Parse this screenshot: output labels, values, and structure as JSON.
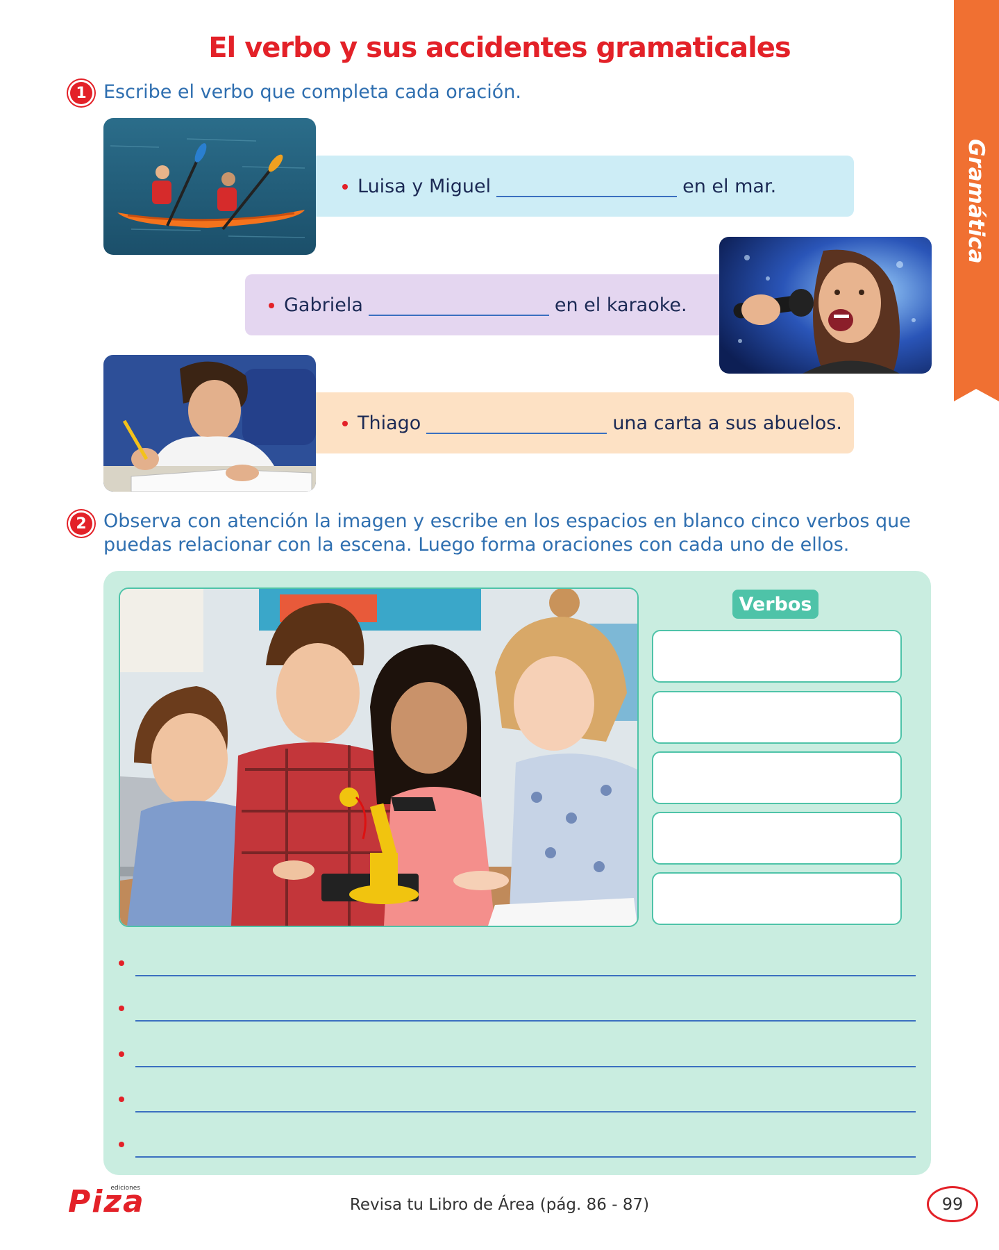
{
  "side_tab": {
    "label": "Gramática",
    "color": "#f07032"
  },
  "title": "El verbo y sus accidentes gramaticales",
  "activity1": {
    "number": "1",
    "instruction": "Escribe el verbo que completa cada oración.",
    "sentences": [
      {
        "before": "Luisa y Miguel",
        "after": "en el mar.",
        "bg": "#cdedf6"
      },
      {
        "before": "Gabriela",
        "after": "en el karaoke.",
        "bg": "#e4d6f0"
      },
      {
        "before": "Thiago",
        "after": "una carta a sus abuelos.",
        "bg": "#fde1c4"
      }
    ]
  },
  "activity2": {
    "number": "2",
    "instruction_line1": "Observa con atención la imagen y escribe en los espacios en blanco cinco verbos que",
    "instruction_line2": "puedas relacionar con la escena. Luego forma oraciones con cada uno de ellos.",
    "verbs_header": "Verbos"
  },
  "footer": {
    "note": "Revisa tu Libro de Área (pág. 86 - 87)",
    "page_number": "99",
    "logo_text": "Piza",
    "logo_small": "ediciones"
  },
  "colors": {
    "accent_red": "#e32128",
    "instruction_blue": "#2f6fb0",
    "panel_green": "#c9ede0",
    "teal": "#4ec3a8"
  }
}
